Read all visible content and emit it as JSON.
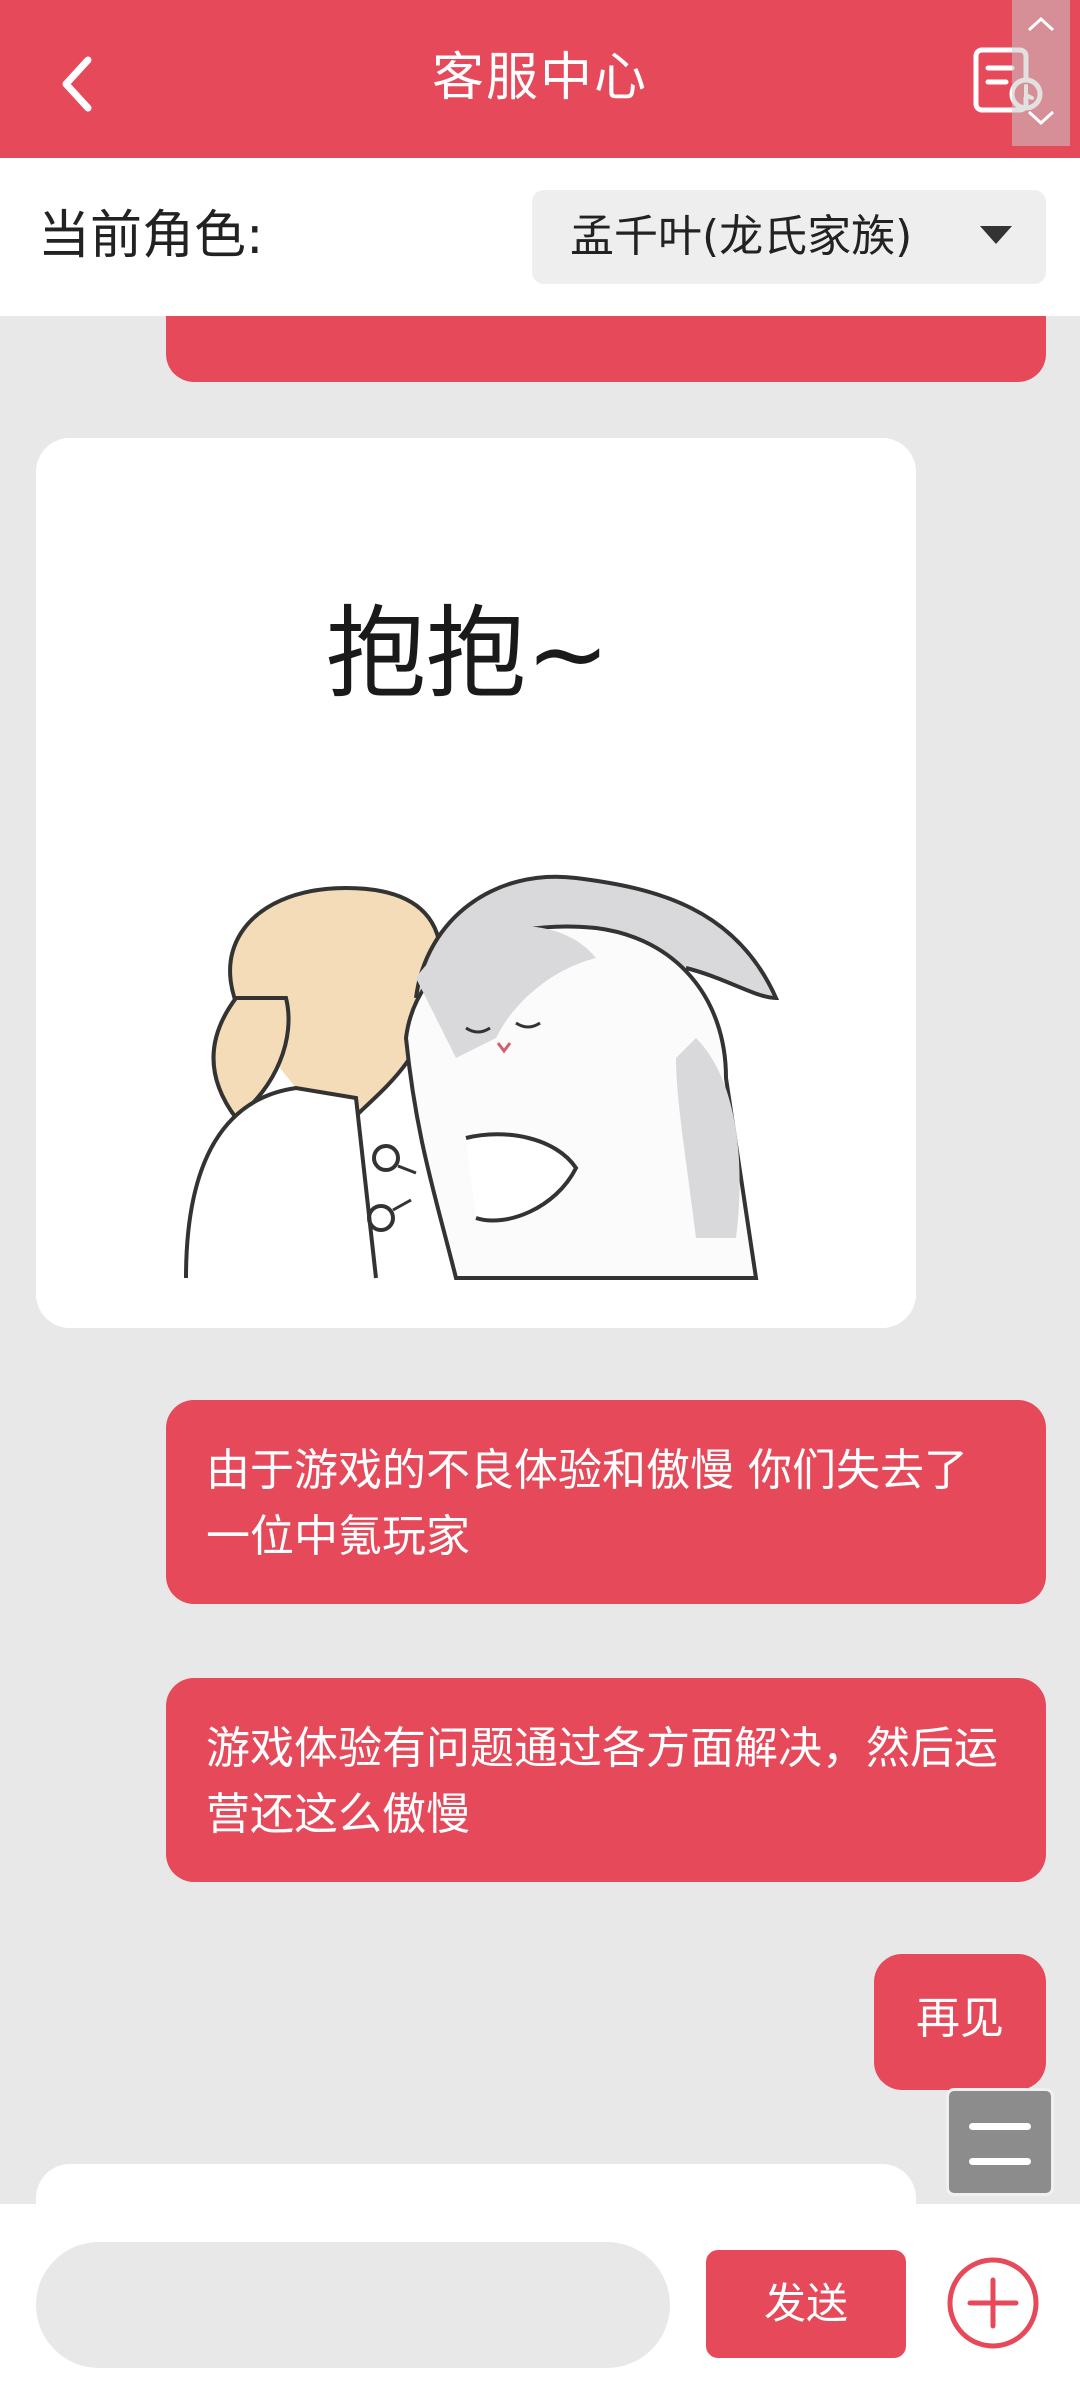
{
  "header": {
    "title": "客服中心",
    "back_icon": "back-arrow-icon",
    "history_icon": "history-document-icon"
  },
  "role": {
    "label": "当前角色:",
    "selected": "孟千叶(龙氏家族)"
  },
  "messages": [
    {
      "side": "right",
      "text": "由于游戏的不良体验和傲慢 你们失去了一位中氪玩家"
    },
    {
      "side": "right",
      "text": "游戏体验有问题通过各方面解决，然后运营还这么傲慢"
    },
    {
      "side": "right",
      "text": "再见"
    }
  ],
  "sticker": {
    "caption": "抱抱~"
  },
  "composer": {
    "placeholder": "",
    "send_label": "发送",
    "plus_icon": "plus-circle-icon"
  },
  "colors": {
    "accent": "#e64a5a",
    "background": "#e8e8e8"
  }
}
